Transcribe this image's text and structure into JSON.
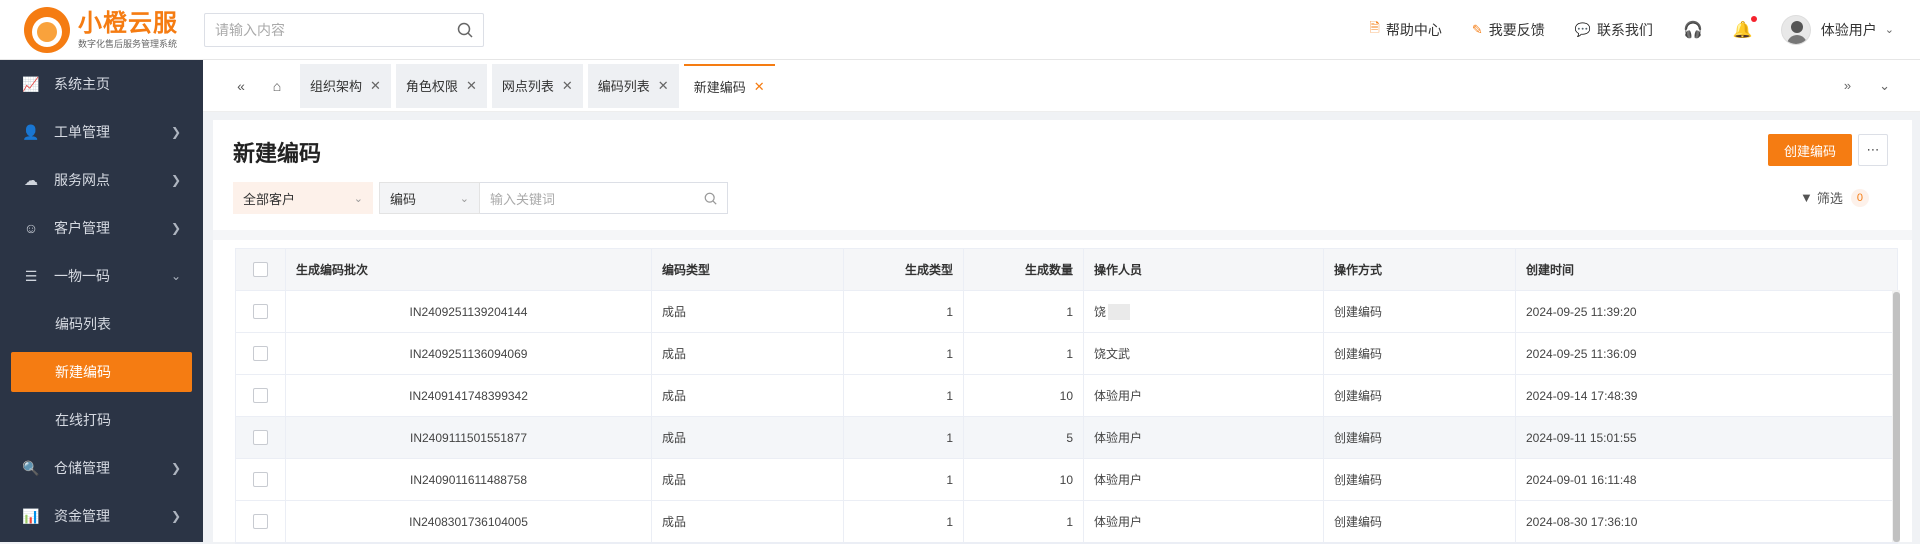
{
  "app": {
    "logo_title": "小橙云服",
    "logo_subtitle": "数字化售后服务管理系统",
    "search_placeholder": "请输入内容"
  },
  "header": {
    "links": [
      {
        "label": "帮助中心",
        "icon": "document-icon"
      },
      {
        "label": "我要反馈",
        "icon": "pen-icon"
      },
      {
        "label": "联系我们",
        "icon": "chat-icon"
      }
    ],
    "user_name": "体验用户"
  },
  "sidebar": {
    "items": [
      {
        "label": "系统主页",
        "icon": "chart-line-icon"
      },
      {
        "label": "工单管理",
        "icon": "user-add-icon"
      },
      {
        "label": "服务网点",
        "icon": "cloud-icon"
      },
      {
        "label": "客户管理",
        "icon": "user-icon"
      },
      {
        "label": "一物一码",
        "icon": "list-icon"
      }
    ],
    "sub_items": [
      {
        "label": "编码列表"
      },
      {
        "label": "新建编码",
        "active": true
      },
      {
        "label": "在线打码"
      }
    ],
    "bottom_items": [
      {
        "label": "仓储管理",
        "icon": "warehouse-icon"
      },
      {
        "label": "资金管理",
        "icon": "bar-chart-icon"
      }
    ]
  },
  "tabs": [
    {
      "label": "组织架构"
    },
    {
      "label": "角色权限"
    },
    {
      "label": "网点列表"
    },
    {
      "label": "编码列表"
    },
    {
      "label": "新建编码",
      "active": true
    }
  ],
  "page": {
    "title": "新建编码",
    "create_button": "创建编码",
    "customer_select": "全部客户",
    "field_select": "编码",
    "keyword_placeholder": "输入关键词",
    "filter_label": "筛选",
    "filter_count": "0"
  },
  "table": {
    "columns": [
      "生成编码批次",
      "编码类型",
      "生成类型",
      "生成数量",
      "操作人员",
      "操作方式",
      "创建时间"
    ],
    "rows": [
      {
        "batch": "IN2409251139204144",
        "type": "成品",
        "gen_type": "1",
        "qty": "1",
        "operator": "饶",
        "method": "创建编码",
        "time": "2024-09-25 11:39:20",
        "blurred": true
      },
      {
        "batch": "IN2409251136094069",
        "type": "成品",
        "gen_type": "1",
        "qty": "1",
        "operator": "饶文武",
        "method": "创建编码",
        "time": "2024-09-25 11:36:09"
      },
      {
        "batch": "IN2409141748399342",
        "type": "成品",
        "gen_type": "1",
        "qty": "10",
        "operator": "体验用户",
        "method": "创建编码",
        "time": "2024-09-14 17:48:39"
      },
      {
        "batch": "IN2409111501551877",
        "type": "成品",
        "gen_type": "1",
        "qty": "5",
        "operator": "体验用户",
        "method": "创建编码",
        "time": "2024-09-11 15:01:55"
      },
      {
        "batch": "IN2409011611488758",
        "type": "成品",
        "gen_type": "1",
        "qty": "10",
        "operator": "体验用户",
        "method": "创建编码",
        "time": "2024-09-01 16:11:48"
      },
      {
        "batch": "IN2408301736104005",
        "type": "成品",
        "gen_type": "1",
        "qty": "1",
        "operator": "体验用户",
        "method": "创建编码",
        "time": "2024-08-30 17:36:10"
      }
    ]
  },
  "colors": {
    "accent": "#f57c12",
    "sidebar_bg": "#2b3445"
  }
}
